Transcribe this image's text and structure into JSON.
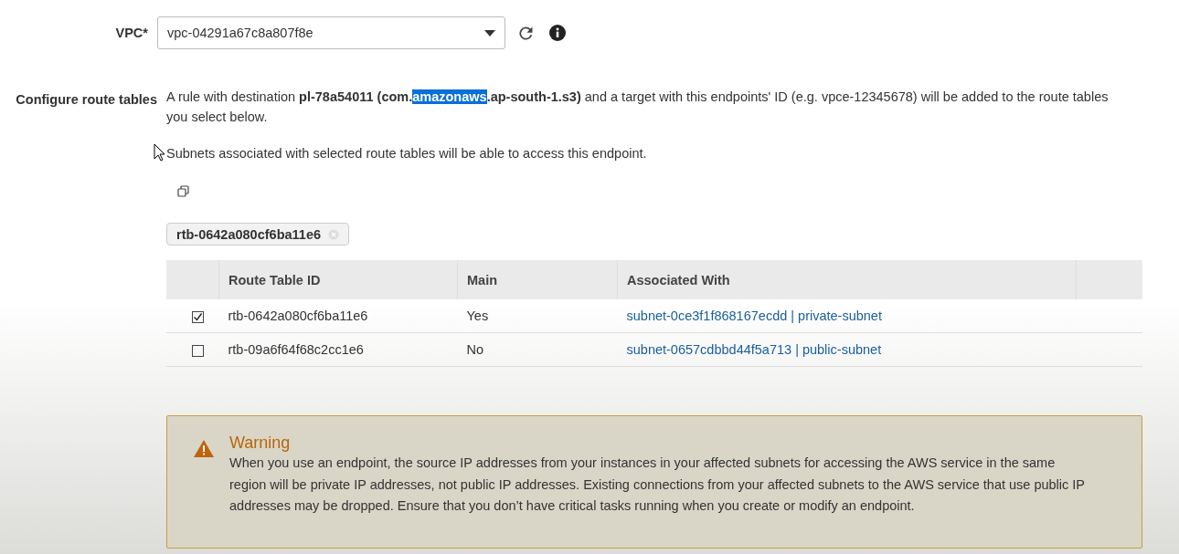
{
  "vpc": {
    "label": "VPC*",
    "value": "vpc-04291a67c8a807f8e"
  },
  "route_tables": {
    "label": "Configure route tables",
    "description": [
      {
        "text": "A rule with destination ",
        "bold": false,
        "selected": false
      },
      {
        "text": "pl-78a54011 (com.",
        "bold": true,
        "selected": false
      },
      {
        "text": "amazonaws",
        "bold": true,
        "selected": true
      },
      {
        "text": ".ap-south-1.s3)",
        "bold": true,
        "selected": false
      },
      {
        "text": " and a target with this endpoints' ID (e.g. vpce-12345678) will be added to the route tables you select below.",
        "bold": false,
        "selected": false
      }
    ],
    "note": "Subnets associated with selected route tables will be able to access this endpoint.",
    "tokens": [
      "rtb-0642a080cf6ba11e6"
    ],
    "table": {
      "columns": [
        "Route Table ID",
        "Main",
        "Associated With"
      ],
      "rows": [
        {
          "selected": true,
          "id": "rtb-0642a080cf6ba11e6",
          "main": "Yes",
          "associated": "subnet-0ce3f1f868167ecdd | private-subnet"
        },
        {
          "selected": false,
          "id": "rtb-09a6f64f68c2cc1e6",
          "main": "No",
          "associated": "subnet-0657cdbbd44f5a713 | public-subnet"
        }
      ]
    }
  },
  "warning": {
    "title": "Warning",
    "text": "When you use an endpoint, the source IP addresses from your instances in your affected subnets for accessing the AWS service in the same region will be private IP addresses, not public IP addresses. Existing connections from your affected subnets to the AWS service that use public IP addresses may be dropped. Ensure that you don’t have critical tasks running when you create or modify an endpoint."
  }
}
